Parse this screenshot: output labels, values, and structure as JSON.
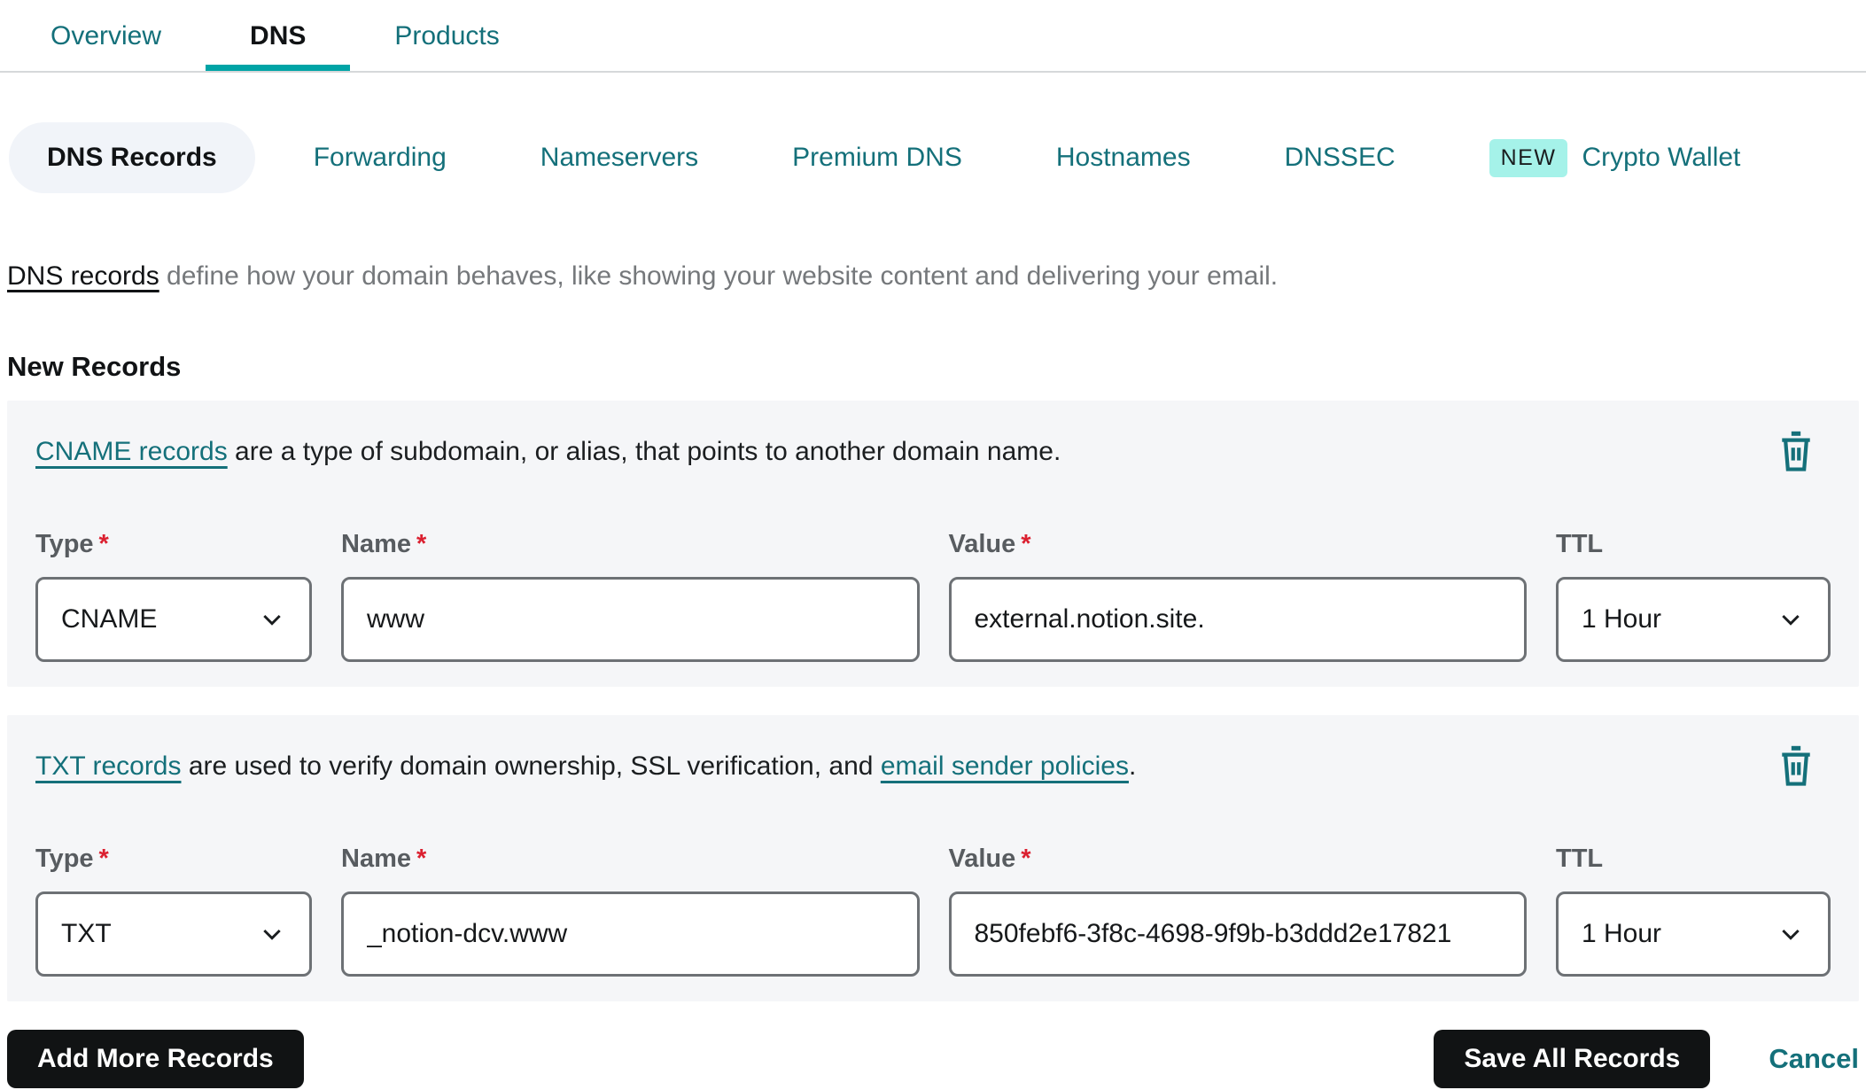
{
  "tabs": {
    "overview": "Overview",
    "dns": "DNS",
    "products": "Products"
  },
  "subtabs": {
    "dns_records": "DNS Records",
    "forwarding": "Forwarding",
    "nameservers": "Nameservers",
    "premium_dns": "Premium DNS",
    "hostnames": "Hostnames",
    "dnssec": "DNSSEC",
    "new_badge": "NEW",
    "crypto_wallet": "Crypto Wallet"
  },
  "intro": {
    "link_text": "DNS records",
    "text": " define how your domain behaves, like showing your website content and delivering your email."
  },
  "section_title": "New Records",
  "ui": {
    "required_marker": "*",
    "trash_icon": "trash-icon",
    "chevron_icon": "chevron-down-icon"
  },
  "colors": {
    "accent_teal": "#00a4a6",
    "link_teal": "#14707a",
    "new_badge_bg": "#a5f2e9",
    "card_bg": "#f5f6f8",
    "active_pill_bg": "#f1f4f9",
    "button_dark": "#111314",
    "required_red": "#db2030"
  },
  "records": [
    {
      "desc": {
        "link1": "CNAME records",
        "mid": " are a type of subdomain, or alias, that points to another domain name.",
        "link2": "",
        "end": ""
      },
      "fields": {
        "type": {
          "label": "Type",
          "value": "CNAME"
        },
        "name": {
          "label": "Name",
          "value": "www"
        },
        "value": {
          "label": "Value",
          "value": "external.notion.site."
        },
        "ttl": {
          "label": "TTL",
          "value": "1 Hour"
        }
      }
    },
    {
      "desc": {
        "link1": "TXT records",
        "mid": " are used to verify domain ownership, SSL verification, and ",
        "link2": "email sender policies",
        "end": "."
      },
      "fields": {
        "type": {
          "label": "Type",
          "value": "TXT"
        },
        "name": {
          "label": "Name",
          "value": "_notion-dcv.www"
        },
        "value": {
          "label": "Value",
          "value": "850febf6-3f8c-4698-9f9b-b3ddd2e17821"
        },
        "ttl": {
          "label": "TTL",
          "value": "1 Hour"
        }
      }
    }
  ],
  "footer": {
    "add_button": "Add More Records",
    "save_button": "Save All Records",
    "cancel_link": "Cancel"
  }
}
